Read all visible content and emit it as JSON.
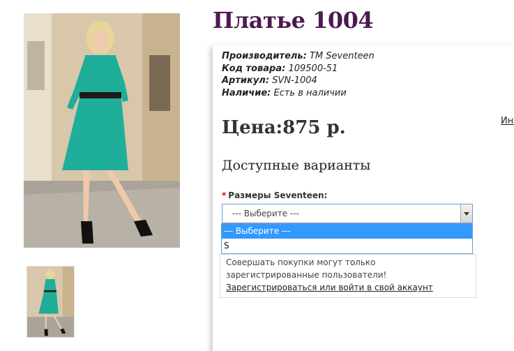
{
  "product": {
    "title": "Платье 1004",
    "manufacturer_label": "Производитель:",
    "manufacturer_value": "ТМ Seventeen",
    "code_label": "Код товара:",
    "code_value": "109500-51",
    "sku_label": "Артикул:",
    "sku_value": "SVN-1004",
    "availability_label": "Наличие:",
    "availability_value": "Есть в наличии",
    "price_label": "Цена:",
    "price_value": "875 р.",
    "side_link": "Ино"
  },
  "options": {
    "title": "Доступные варианты",
    "size_label": "Размеры Seventeen:",
    "required_mark": "*",
    "selected": "--- Выберите ---",
    "items": [
      "--- Выберите ---",
      "S"
    ]
  },
  "notice": {
    "text": "Совершать покупки могут только зарегистрированные пользователи!",
    "link": "Зарегистрироваться или войти в свой аккаунт"
  },
  "colors": {
    "title": "#4b1a4f",
    "dress": "#1fae99",
    "dropdown_highlight": "#3399ff",
    "required": "#e00000"
  }
}
